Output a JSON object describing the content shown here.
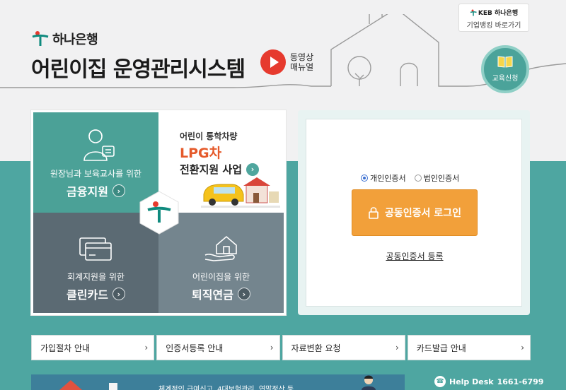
{
  "header": {
    "brand_name": "하나은행",
    "system_title": "어린이집 운영관리시스템",
    "video_manual": {
      "line1": "동영상",
      "line2": "매뉴얼"
    },
    "corp_banking": {
      "brand": "KEB 하나은행",
      "label": "기업뱅킹 바로가기"
    },
    "edu_button": {
      "label": "교육신청",
      "icon": "book-icon"
    }
  },
  "promo": {
    "finance": {
      "sub": "원장님과 보육교사를 위한",
      "main": "금융지원",
      "icon": "teacher-icon"
    },
    "lpg": {
      "sub": "어린이 통학차량",
      "title": "LPG차",
      "main": "전환지원 사업",
      "icon": "school-bus-icon"
    },
    "card": {
      "sub": "회계지원을 위한",
      "main": "클린카드",
      "icon": "credit-card-icon"
    },
    "pension": {
      "sub": "어린이집을 위한",
      "main": "퇴직연금",
      "icon": "house-hand-icon"
    }
  },
  "login": {
    "cert_types": [
      {
        "label": "개인인증서",
        "checked": true
      },
      {
        "label": "법인인증서",
        "checked": false
      }
    ],
    "login_button": "공동인증서 로그인",
    "register_link": "공동인증서 등록"
  },
  "quick_nav": [
    {
      "label": "가입절차 안내"
    },
    {
      "label": "인증서등록 안내"
    },
    {
      "label": "자료변환 요청"
    },
    {
      "label": "카드발급 안내"
    }
  ],
  "banner": {
    "text": "체계적인 급여신고, 4대보험관리, 연말정산 등"
  },
  "helpdesk": {
    "label": "Help Desk",
    "number": "1661-6799"
  },
  "colors": {
    "teal": "#4ea6a1",
    "orange": "#f2a03a",
    "red": "#e63a2e",
    "slate": "#5b6a73"
  }
}
